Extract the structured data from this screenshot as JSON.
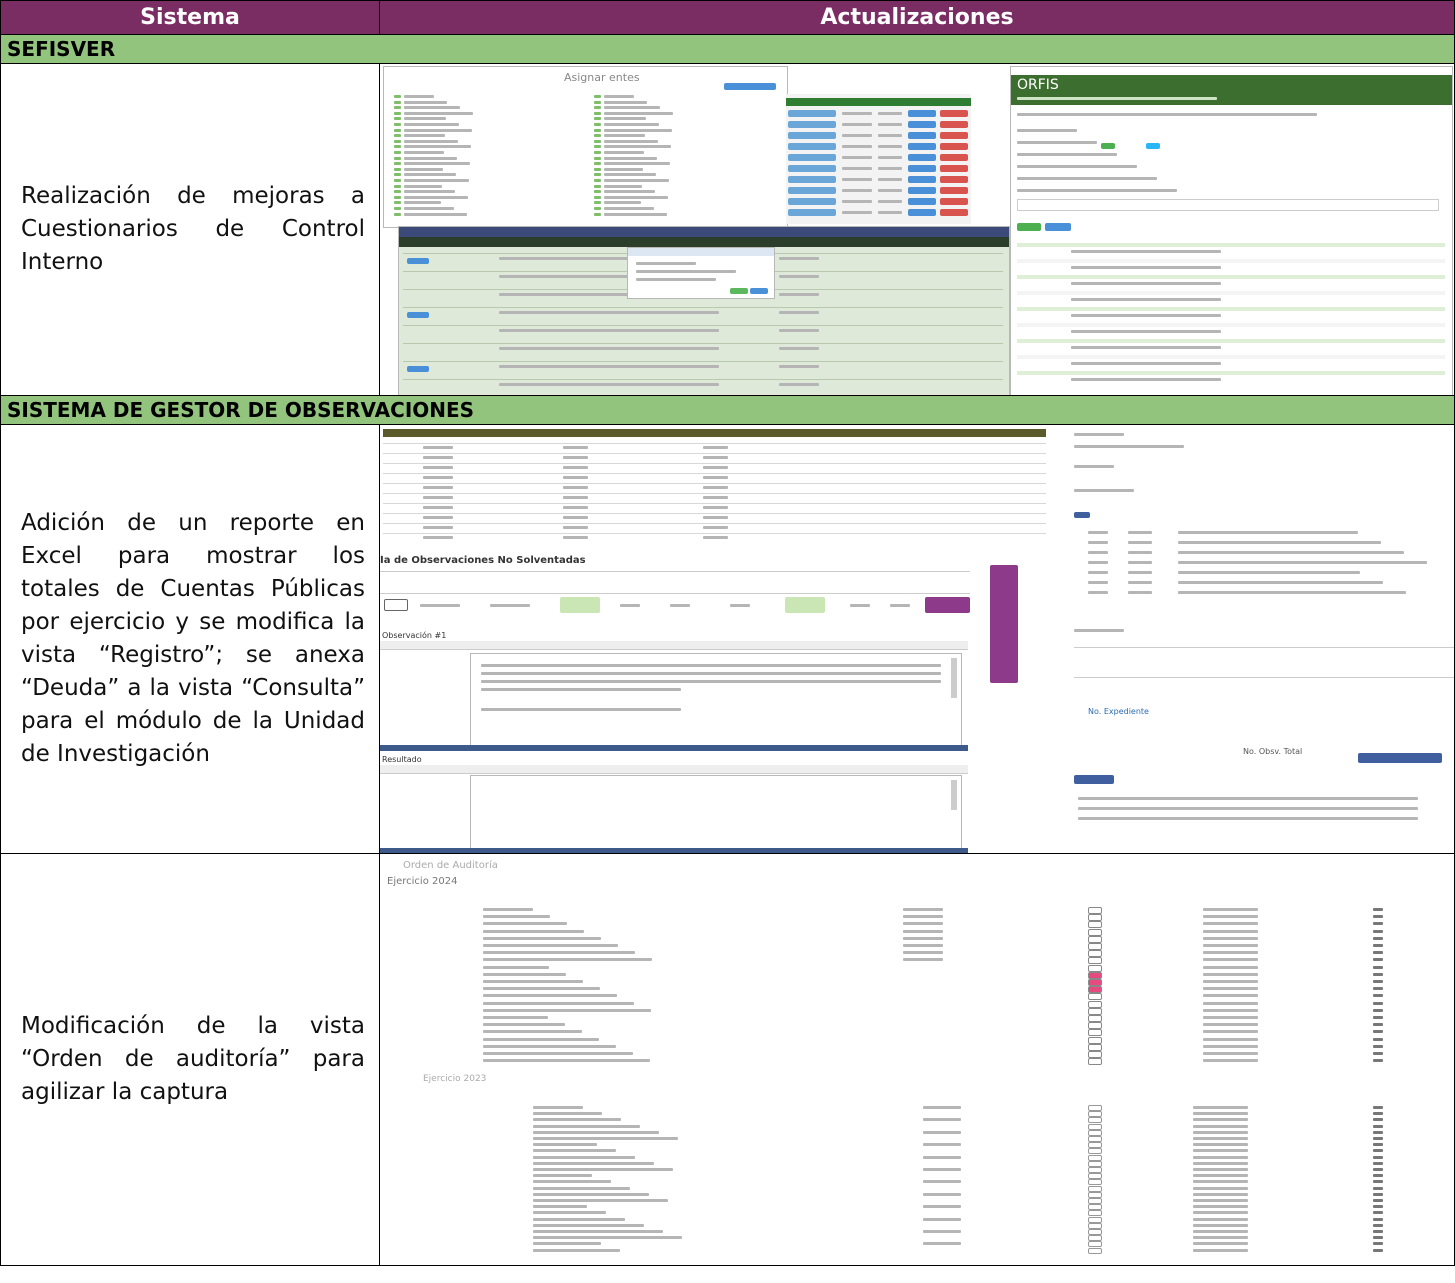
{
  "table": {
    "header": {
      "col1": "Sistema",
      "col2": "Actualizaciones"
    },
    "sections": [
      {
        "title": "SEFISVER"
      },
      {
        "title": "SISTEMA DE GESTOR DE OBSERVACIONES"
      }
    ],
    "rows": [
      {
        "description": "Realización de mejoras a Cuestionarios de Control Interno"
      },
      {
        "description": "Adición de un reporte en Excel para mostrar los totales de Cuentas Públicas por ejercicio y se modifica la vista “Registro”; se anexa “Deuda” a la vista “Consulta” para el módulo de la Unidad de Investigación"
      },
      {
        "description": "Modificación de la vista “Orden de auditoría” para agilizar la captura"
      }
    ]
  },
  "screens": {
    "asignar_title": "Asignar entes",
    "orfis_title": "ORFIS",
    "observaciones_title": "Ía de Observaciones No Solventadas",
    "observacion_label": "Observación #1",
    "resultado_label": "Resultado",
    "orden_label": "Orden de Auditoría",
    "ejercicio_2024": "Ejercicio 2024",
    "ejercicio_2023": "Ejercicio 2023",
    "no_expediente": "No. Expediente",
    "no_obsv_total": "No. Obsv. Total"
  }
}
